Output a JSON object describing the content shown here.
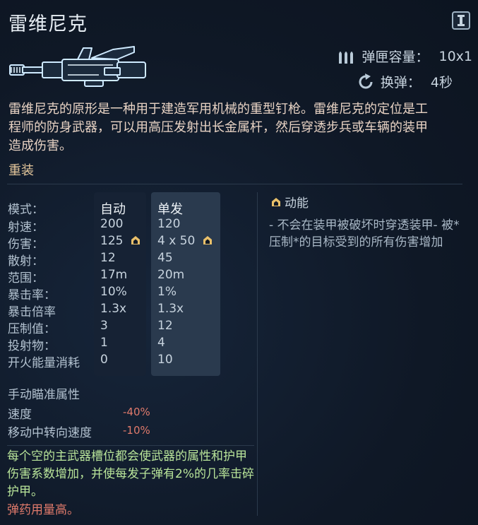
{
  "weapon": {
    "name": "雷维尼克",
    "description": "雷维尼克的原形是一种用于建造军用机械的重型钉枪。雷维尼克的定位是工程师的防身武器，可以用高压发射出长金属杆，然后穿透步兵或车辆的装甲造成伤害。",
    "category": "重装",
    "icon": "nailgun-weapon-icon"
  },
  "header_stats": {
    "magazine": {
      "icon": "ammo-icon",
      "label": "弹匣容量：",
      "value": "10x1"
    },
    "reload": {
      "icon": "reload-icon",
      "label": "换弹：",
      "value": "4秒"
    }
  },
  "stats_table": {
    "headers": {
      "mode": "模式：",
      "auto": "自动",
      "single": "单发"
    },
    "rows": [
      {
        "label": "射速：",
        "auto": "200",
        "single": "120"
      },
      {
        "label": "伤害：",
        "auto": "125",
        "single": "4 x 50"
      },
      {
        "label": "散射：",
        "auto": "12",
        "single": "45"
      },
      {
        "label": "范围：",
        "auto": "17m",
        "single": "20m"
      },
      {
        "label": "暴击率：",
        "auto": "10%",
        "single": "1%"
      },
      {
        "label": "暴击倍率",
        "auto": "1.3x",
        "single": "1.3x"
      },
      {
        "label": "压制值：",
        "auto": "3",
        "single": "12"
      },
      {
        "label": "投射物：",
        "auto": "1",
        "single": "4"
      },
      {
        "label": "开火能量消耗",
        "auto": "0",
        "single": "10"
      }
    ]
  },
  "trait": {
    "title": "动能",
    "icon": "kinetic-badge-icon",
    "description": "- 不会在装甲被破坏时穿透装甲- 被*压制*的目标受到的所有伤害增加"
  },
  "manual_aim": {
    "title": "手动瞄准属性",
    "rows": [
      {
        "label": "速度",
        "value": "-40%"
      },
      {
        "label": "移动中转向速度",
        "value": "-10%"
      }
    ]
  },
  "bonus_text": "每个空的主武器槽位都会使武器的属性和护甲伤害系数增加，并使每发子弹有2%的几率击碎护甲。",
  "ammo_note": "弹药用量高。",
  "colors": {
    "background": "#0f1826",
    "accent_gold": "#e3c69b",
    "bonus_green": "#b9e59a",
    "penalty_red": "#e07a6b",
    "column_highlight": "#2a3a4e"
  }
}
